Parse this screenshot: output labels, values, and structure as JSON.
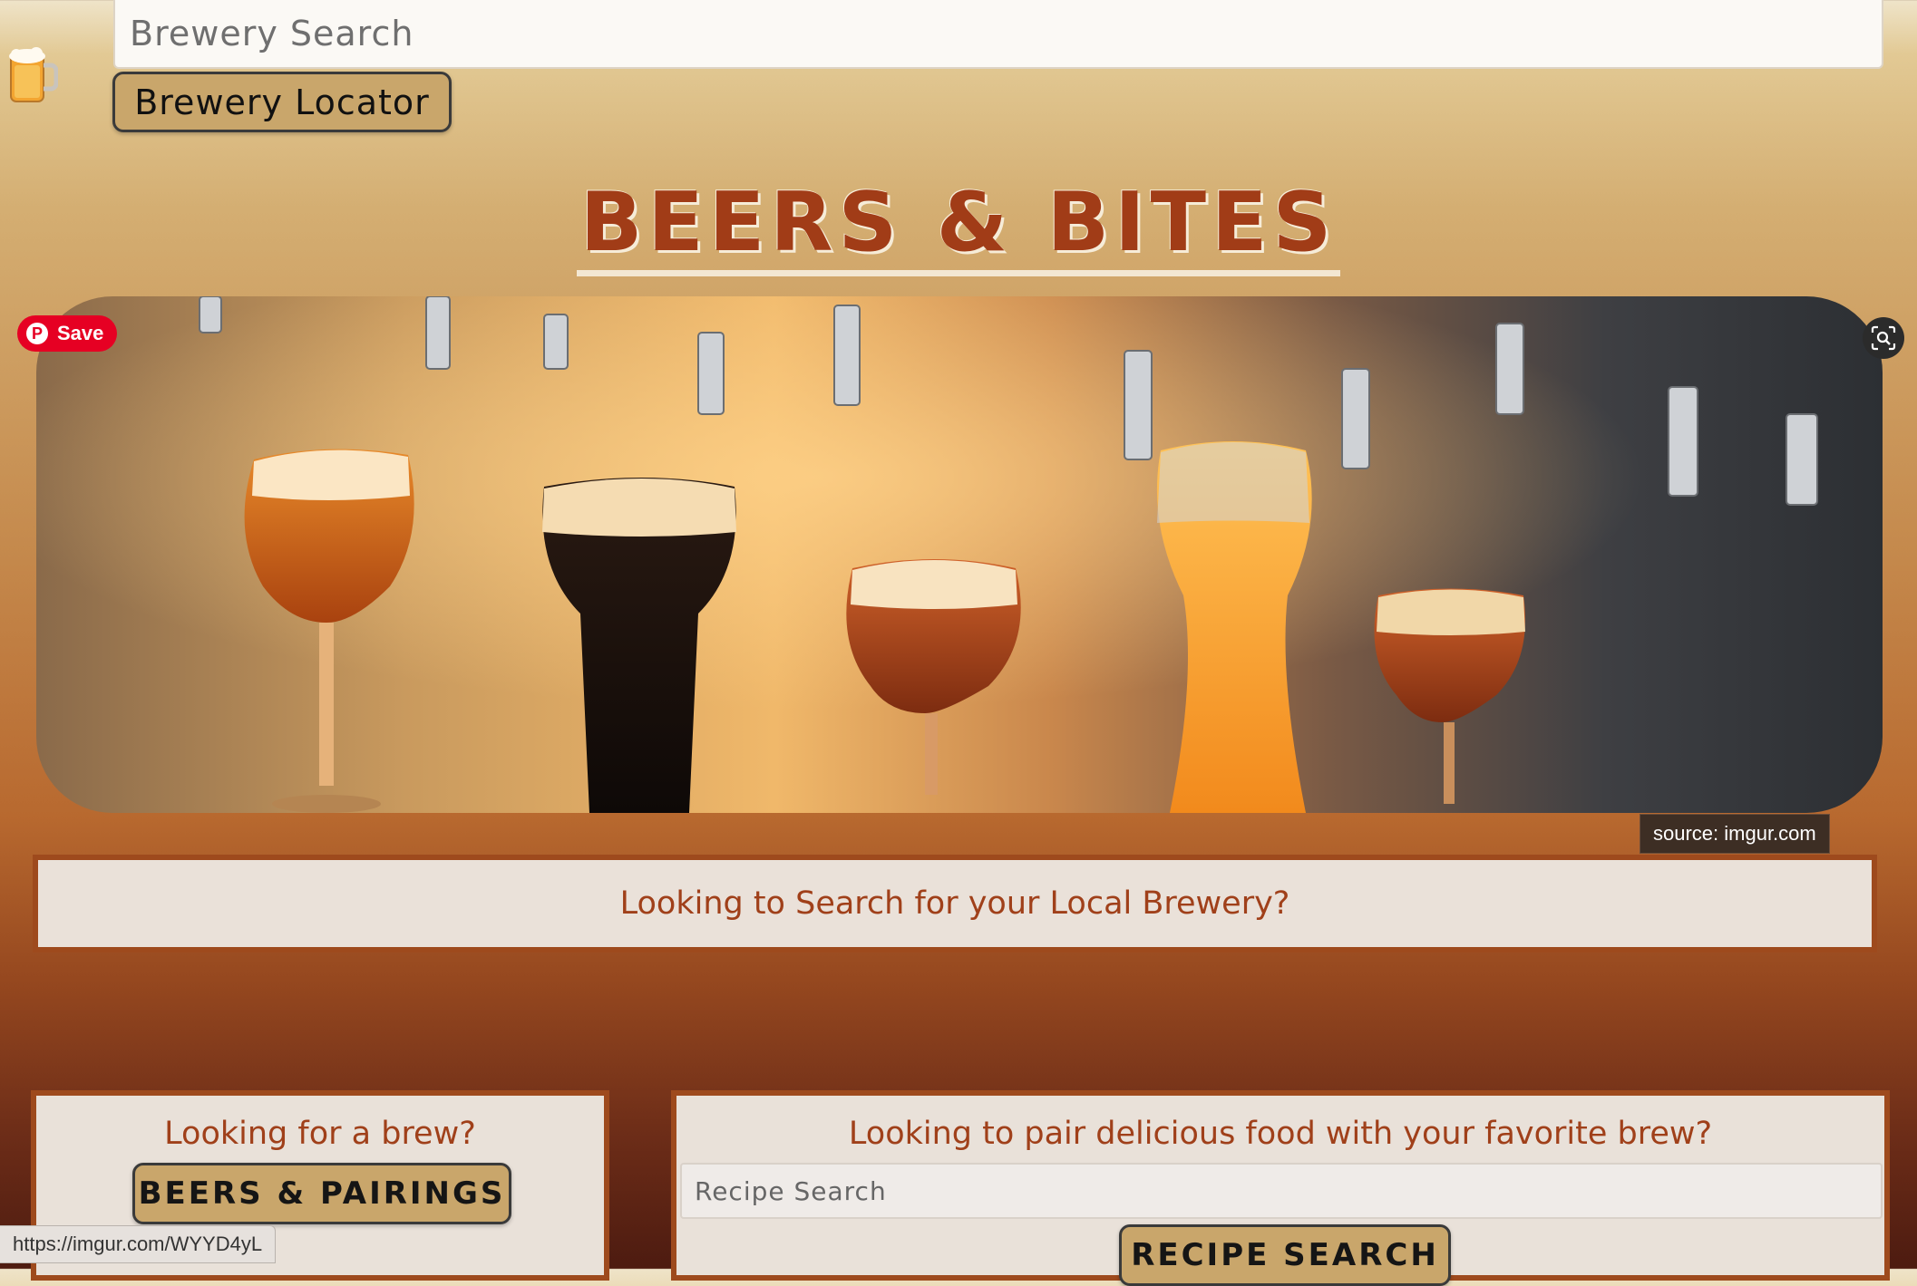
{
  "header": {
    "search_placeholder": "Brewery Search",
    "locator_label": "Brewery Locator",
    "logo_icon": "beer-mug-icon"
  },
  "title": "BEERS & BITES",
  "hero": {
    "save_label": "Save",
    "source_label": "source: imgur.com",
    "lens_icon": "visual-search-icon"
  },
  "local_section": {
    "text": "Looking to Search for your Local Brewery?"
  },
  "brew_section": {
    "heading": "Looking for a brew?",
    "button_label": "BEERS & PAIRINGS"
  },
  "pair_section": {
    "heading": "Looking to pair delicious food with your favorite brew?",
    "search_placeholder": "Recipe Search",
    "button_label": "RECIPE SEARCH"
  },
  "status_bar": {
    "url": "https://imgur.com/WYYD4yL"
  },
  "colors": {
    "accent_text": "#a0401a",
    "box_border": "#9e4a1d",
    "button_bg": "#c9a66b",
    "pinterest_red": "#e60023"
  }
}
